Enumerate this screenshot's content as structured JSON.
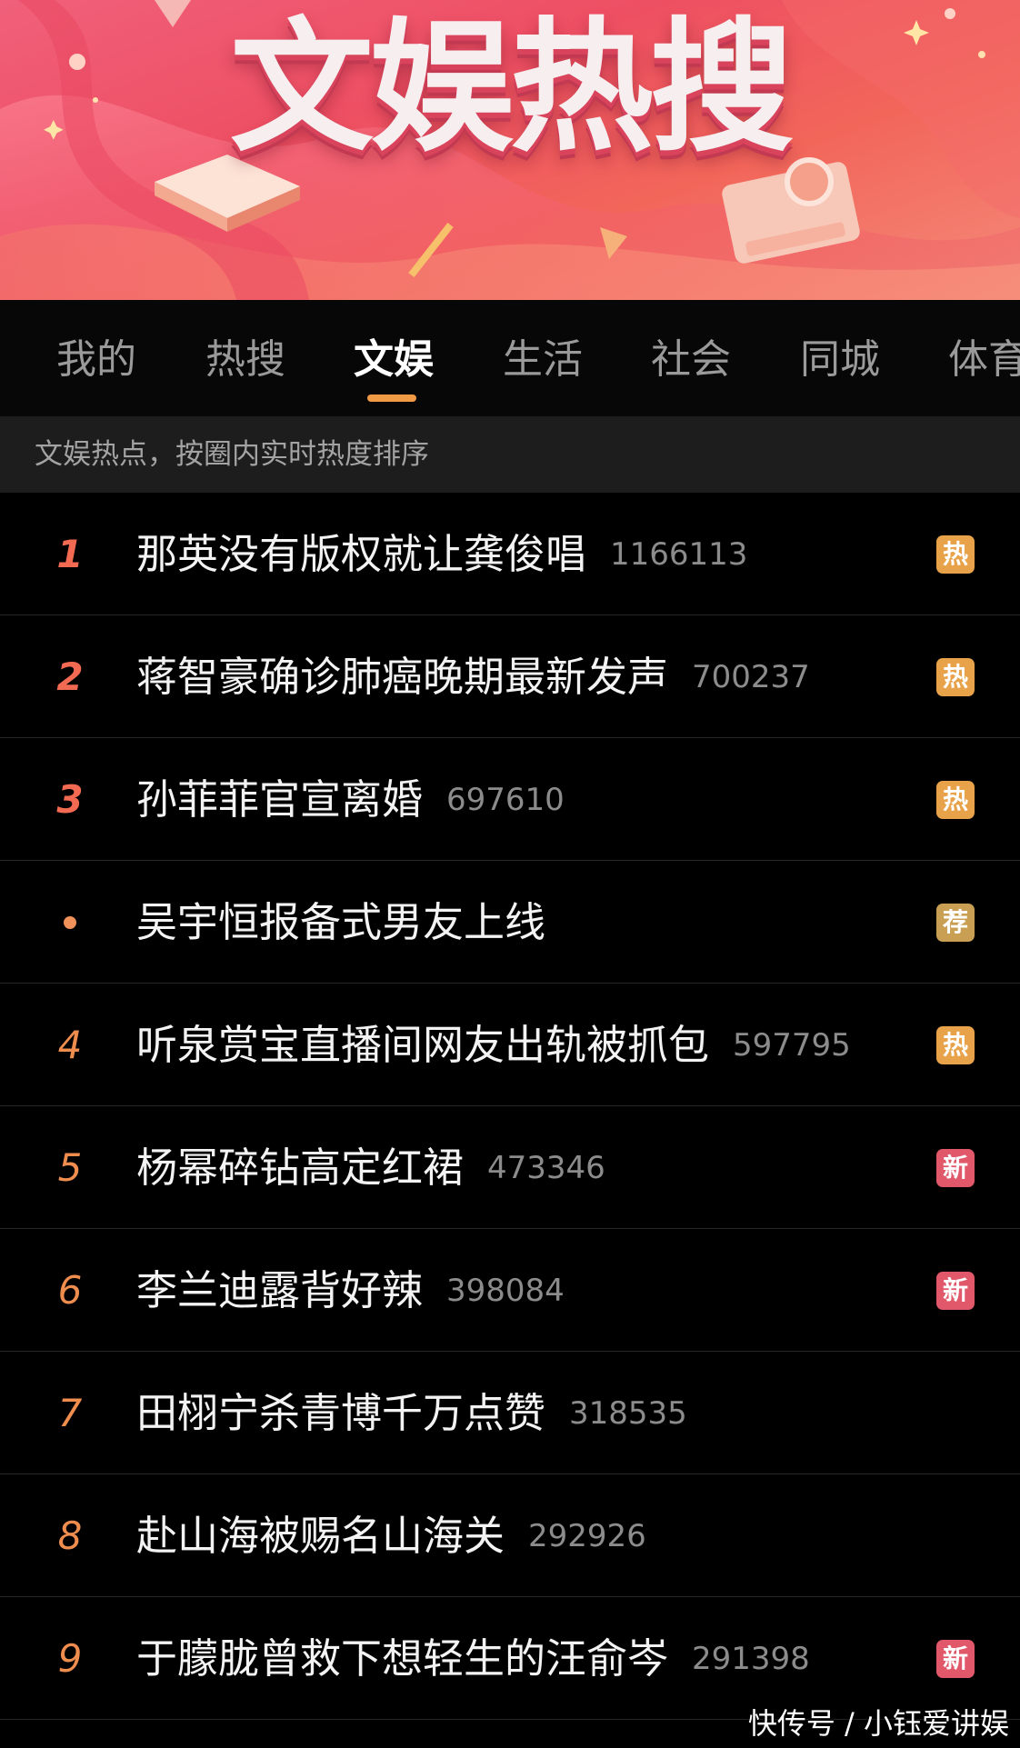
{
  "banner": {
    "title": "文娱热搜"
  },
  "tabs": [
    {
      "label": "我的",
      "active": false
    },
    {
      "label": "热搜",
      "active": false
    },
    {
      "label": "文娱",
      "active": true
    },
    {
      "label": "生活",
      "active": false
    },
    {
      "label": "社会",
      "active": false
    },
    {
      "label": "同城",
      "active": false
    },
    {
      "label": "体育",
      "active": false
    }
  ],
  "subheader": {
    "text": "文娱热点，按圈内实时热度排序"
  },
  "list": [
    {
      "rank": "1",
      "rank_style": "top",
      "title": "那英没有版权就让龚俊唱",
      "count": "1166113",
      "badge": "热",
      "badge_color": "#e8a24a"
    },
    {
      "rank": "2",
      "rank_style": "top",
      "title": "蒋智豪确诊肺癌晚期最新发声",
      "count": "700237",
      "badge": "热",
      "badge_color": "#e8a24a"
    },
    {
      "rank": "3",
      "rank_style": "top",
      "title": "孙菲菲官宣离婚",
      "count": "697610",
      "badge": "热",
      "badge_color": "#e8a24a"
    },
    {
      "rank": "",
      "rank_style": "dot",
      "title": "吴宇恒报备式男友上线",
      "count": "",
      "badge": "荐",
      "badge_color": "#c9a053"
    },
    {
      "rank": "4",
      "rank_style": "normal",
      "title": "听泉赏宝直播间网友出轨被抓包",
      "count": "597795",
      "badge": "热",
      "badge_color": "#e8a24a"
    },
    {
      "rank": "5",
      "rank_style": "normal",
      "title": "杨幂碎钻高定红裙",
      "count": "473346",
      "badge": "新",
      "badge_color": "#e0586a"
    },
    {
      "rank": "6",
      "rank_style": "normal",
      "title": "李兰迪露背好辣",
      "count": "398084",
      "badge": "新",
      "badge_color": "#e0586a"
    },
    {
      "rank": "7",
      "rank_style": "normal",
      "title": "田栩宁杀青博千万点赞",
      "count": "318535",
      "badge": "",
      "badge_color": ""
    },
    {
      "rank": "8",
      "rank_style": "normal",
      "title": "赴山海被赐名山海关",
      "count": "292926",
      "badge": "",
      "badge_color": ""
    },
    {
      "rank": "9",
      "rank_style": "normal",
      "title": "于朦胧曾救下想轻生的汪俞岑",
      "count": "291398",
      "badge": "新",
      "badge_color": "#e0586a"
    }
  ],
  "watermark": {
    "text": "快传号 / 小钰爱讲娱"
  },
  "colors": {
    "accent": "#f19a45",
    "rank_top": "#f26a52",
    "rank_normal": "#ef8d4f"
  }
}
